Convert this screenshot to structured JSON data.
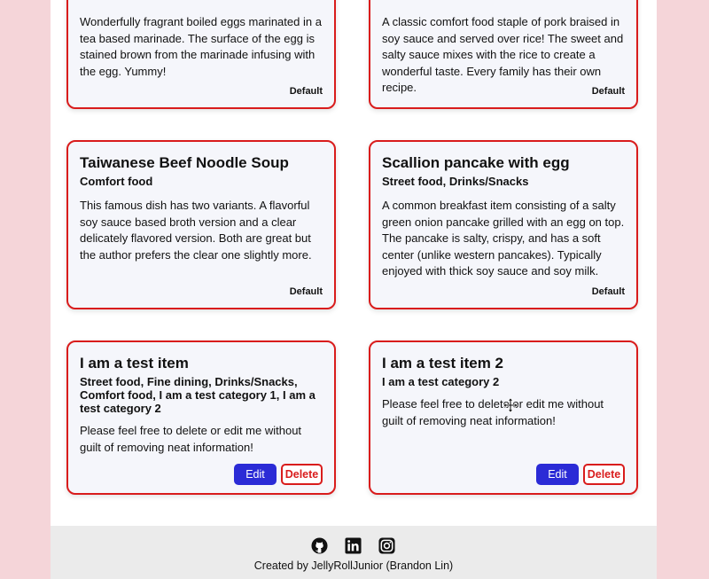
{
  "cards": [
    {
      "title": "",
      "category": "",
      "description": "Wonderfully fragrant boiled eggs marinated in a tea based marinade. The surface of the egg is stained brown from the marinade infusing with the egg. Yummy!",
      "badge": "Default"
    },
    {
      "title": "",
      "category": "",
      "description": "A classic comfort food staple of pork braised in soy sauce and served over rice! The sweet and salty sauce mixes with the rice to create a wonderful taste. Every family has their own recipe.",
      "badge": "Default"
    },
    {
      "title": "Taiwanese Beef Noodle Soup",
      "category": "Comfort food",
      "description": "This famous dish has two variants. A flavorful soy sauce based broth version and a clear delicately flavored version. Both are great but the author prefers the clear one slightly more.",
      "badge": "Default"
    },
    {
      "title": "Scallion pancake with egg",
      "category": "Street food, Drinks/Snacks",
      "description": "A common breakfast item consisting of a salty green onion pancake grilled with an egg on top. The pancake is salty, crispy, and has a soft center (unlike western pancakes). Typically enjoyed with thick soy sauce and soy milk.",
      "badge": "Default"
    },
    {
      "title": "I am a test item",
      "category": "Street food, Fine dining, Drinks/Snacks, Comfort food, I am a test category 1, I am a test category 2",
      "description": "Please feel free to delete or edit me without guilt of removing neat information!",
      "edit_label": "Edit",
      "delete_label": "Delete"
    },
    {
      "title": "I am a test item 2",
      "category": "I am a test category 2",
      "description": "Please feel free to delete or edit me without guilt of removing neat information!",
      "edit_label": "Edit",
      "delete_label": "Delete"
    }
  ],
  "footer": {
    "icons": [
      "github-icon",
      "linkedin-icon",
      "instagram-icon"
    ],
    "credit": "Created by JellyRollJunior (Brandon Lin)"
  },
  "colors": {
    "page_background": "#f5d5d9",
    "card_border": "#d91c1c",
    "card_background": "#f5f6fb",
    "edit_button": "#2b2bd6",
    "delete_text": "#d91c1c",
    "footer_background": "#ebebeb"
  }
}
